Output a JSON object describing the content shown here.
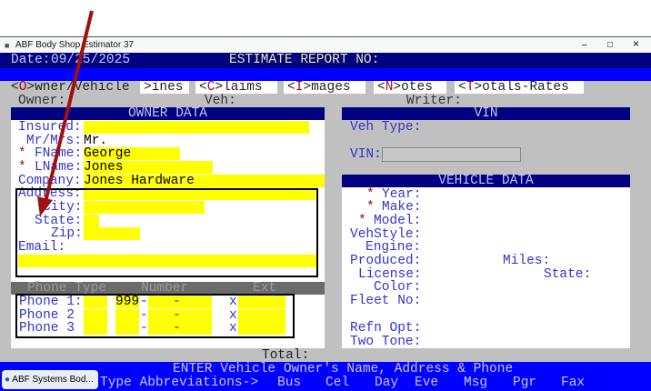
{
  "window": {
    "title": "ABF Body Shop Estimator 37",
    "minimize": "–",
    "maximize": "□",
    "close": "×"
  },
  "header": {
    "date_label": "Date:",
    "date": "09/25/2025",
    "report_label": "ESTIMATE REPORT NO:"
  },
  "tabs": [
    {
      "key": "O",
      "rest": "wner/Vehicle"
    },
    {
      "key": "L",
      "rest": "ines",
      "shown": ">ines"
    },
    {
      "key": "C",
      "rest": "laims"
    },
    {
      "key": "I",
      "rest": "mages"
    },
    {
      "key": "N",
      "rest": "otes"
    },
    {
      "key": "T",
      "rest": "otals-Rates"
    }
  ],
  "info": {
    "owner": "Owner:",
    "veh": "Veh:",
    "writer": "Writer:"
  },
  "owner": {
    "title": "OWNER DATA",
    "insured": "Insured:",
    "mrmrs": "Mr/Mrs:",
    "mrmrs_value": "Mr.",
    "fname": "FName:",
    "fname_value": "George",
    "lname": "LName:",
    "lname_value": "Jones",
    "company": "Company:",
    "company_value": "Jones Hardware",
    "address": "Address:",
    "city": "City:",
    "state": "State:",
    "zip": "Zip:",
    "email": "Email:"
  },
  "phones": {
    "headers": [
      "Phone Type",
      "Number",
      "Ext"
    ],
    "rows": [
      {
        "label": "Phone 1:",
        "area": "999",
        "sep": "-",
        "dash": "-",
        "x": "x"
      },
      {
        "label": "Phone 2",
        "area": "",
        "sep": "-",
        "dash": "-",
        "x": "x"
      },
      {
        "label": "Phone 3",
        "area": "",
        "sep": "-",
        "dash": "-",
        "x": "x"
      }
    ]
  },
  "vin": {
    "title": "VIN",
    "veh_type": "Veh Type:",
    "vin_label": "VIN:",
    "vin_value": ""
  },
  "vehicle": {
    "title": "VEHICLE DATA",
    "year": "Year:",
    "make": "Make:",
    "model": "Model:",
    "vehstyle": "VehStyle:",
    "engine": "Engine:",
    "produced": "Produced:",
    "miles": "Miles:",
    "license": "License:",
    "state": "State:",
    "color": "Color:",
    "fleet": "Fleet No:",
    "refn": "Refn Opt:",
    "twotone": "Two Tone:"
  },
  "total": "Total:",
  "status": {
    "message": "ENTER Vehicle Owner's Name, Address & Phone",
    "abbrev": "Type Abbreviations->",
    "types": [
      "Bus",
      "Cel",
      "Day",
      "Eve",
      "Msg",
      "Pgr",
      "Fax"
    ]
  },
  "taskbar": {
    "label": "ABF Systems Bod..."
  },
  "colors": {
    "navy": "#000080",
    "blue": "#0000ff",
    "yellow": "#ffff00",
    "gray": "#c0c0c0",
    "arrow": "#a01010"
  }
}
